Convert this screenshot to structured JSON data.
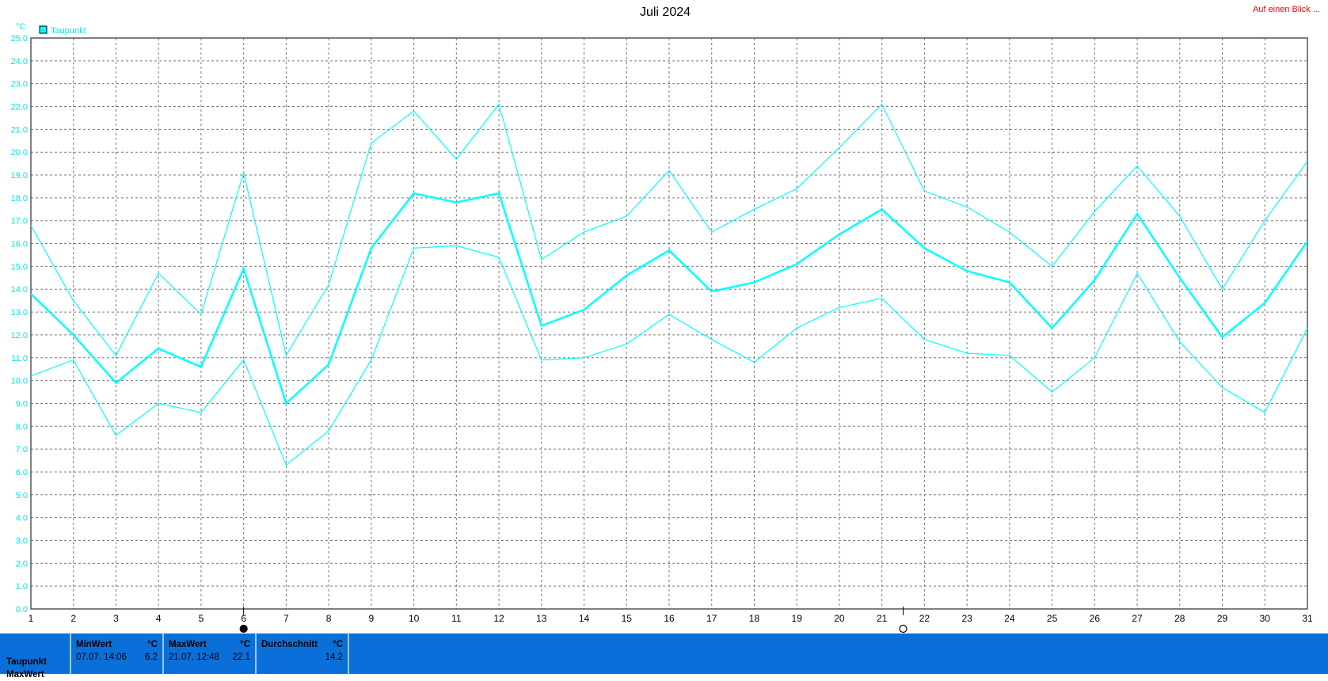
{
  "header": {
    "title": "Juli 2024",
    "link_label": "Auf einen Blick ..."
  },
  "colors": {
    "series": "#00ffff",
    "series_text": "#00e5ee",
    "grid": "#7a7a7a",
    "axis": "#555555",
    "stats_bg": "#0a6fd8",
    "link": "#ff0000"
  },
  "chart_data": {
    "type": "line",
    "title": "Juli 2024",
    "ylabel": "°C",
    "xlabel": "",
    "ylim": [
      0,
      25
    ],
    "xlim": [
      1,
      31
    ],
    "grid": true,
    "legend_position": "top-left",
    "y_ticks": [
      "0.0",
      "1.0",
      "2.0",
      "3.0",
      "4.0",
      "5.0",
      "6.0",
      "7.0",
      "8.0",
      "9.0",
      "10.0",
      "11.0",
      "12.0",
      "13.0",
      "14.0",
      "15.0",
      "16.0",
      "17.0",
      "18.0",
      "19.0",
      "20.0",
      "21.0",
      "22.0",
      "23.0",
      "24.0",
      "25.0"
    ],
    "x": [
      1,
      2,
      3,
      4,
      5,
      6,
      7,
      8,
      9,
      10,
      11,
      12,
      13,
      14,
      15,
      16,
      17,
      18,
      19,
      20,
      21,
      22,
      23,
      24,
      25,
      26,
      27,
      28,
      29,
      30,
      31
    ],
    "series": [
      {
        "name": "Taupunkt",
        "values": [
          13.8,
          12.0,
          9.9,
          11.4,
          10.6,
          14.9,
          9.0,
          10.7,
          15.8,
          18.2,
          17.8,
          18.2,
          12.4,
          13.1,
          14.6,
          15.7,
          13.9,
          14.3,
          15.1,
          16.4,
          17.5,
          15.8,
          14.8,
          14.3,
          12.3,
          14.4,
          17.3,
          14.5,
          11.9,
          13.4,
          16.1
        ]
      },
      {
        "values": [
          16.8,
          13.5,
          11.1,
          14.7,
          12.9,
          19.1,
          11.1,
          14.2,
          20.4,
          21.8,
          19.7,
          22.1,
          15.3,
          16.5,
          17.2,
          19.2,
          16.5,
          17.5,
          18.4,
          20.2,
          22.1,
          18.3,
          17.6,
          16.5,
          15.0,
          17.4,
          19.4,
          17.2,
          14.0,
          17.0,
          19.6
        ]
      },
      {
        "values": [
          10.2,
          10.9,
          7.6,
          9.0,
          8.6,
          10.9,
          6.3,
          7.8,
          10.9,
          15.8,
          15.9,
          15.4,
          10.9,
          11.0,
          11.6,
          12.9,
          11.8,
          10.8,
          12.3,
          13.2,
          13.6,
          11.8,
          11.2,
          11.1,
          9.5,
          11.0,
          14.7,
          11.7,
          9.7,
          8.6,
          12.3
        ]
      }
    ],
    "markers": [
      {
        "x": 6,
        "type": "filled-circle"
      },
      {
        "x": 21.5,
        "type": "open-circle"
      }
    ]
  },
  "stats": {
    "row_labels": [
      "Taupunkt",
      "MaxWert"
    ],
    "min": {
      "header": "MinWert",
      "unit": "°C",
      "date": "07.07.  14:06",
      "value": "6.2"
    },
    "max": {
      "header": "MaxWert",
      "unit": "°C",
      "date": "21.07.  12:48",
      "value": "22.1"
    },
    "avg": {
      "header": "Durchschnitt",
      "unit": "°C",
      "value": "14.2"
    }
  }
}
